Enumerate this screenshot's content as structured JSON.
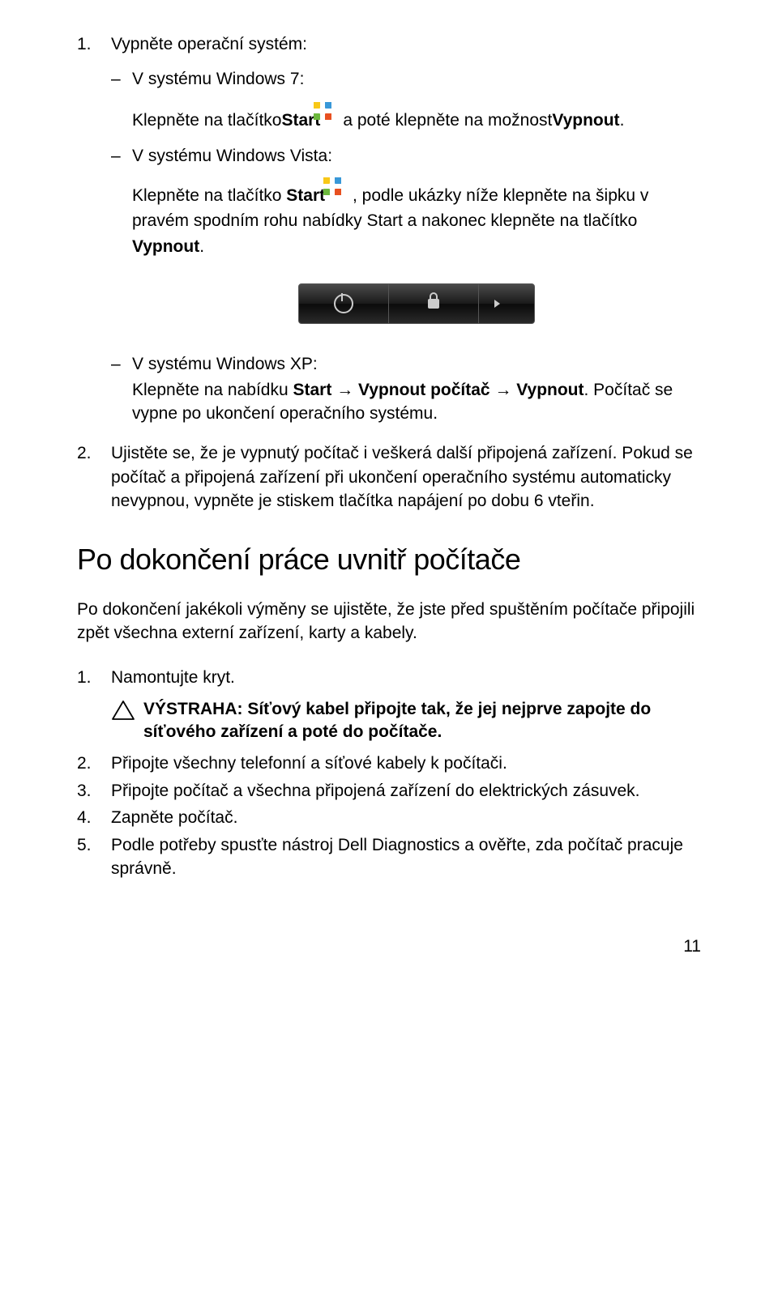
{
  "step1": {
    "num": "1.",
    "title": "Vypněte operační systém:",
    "win7": {
      "dash": "–",
      "label": "V systému Windows 7:",
      "click_pre": "Klepněte na tlačítko ",
      "start": "Start",
      "click_post": " a poté klepněte na možnost ",
      "vypnout": "Vypnout",
      "period": "."
    },
    "vista": {
      "dash": "–",
      "label": "V systému Windows Vista:",
      "line1_pre": "Klepněte na tlačítko ",
      "start": "Start",
      "line1_post": ", podle ukázky níže klepněte na šipku v pravém spodním rohu nabídky Start a nakonec klepněte na tlačítko ",
      "vypnout": "Vypnout",
      "period": "."
    },
    "xp": {
      "dash": "–",
      "label": "V systému Windows XP:",
      "line_pre": "Klepněte na nabídku ",
      "start": "Start",
      "arrow1": " → ",
      "vypnout_pc": "Vypnout počítač",
      "arrow2": " → ",
      "vypnout": "Vypnout",
      "line_post": ". Počítač se vypne po ukončení operačního systému."
    }
  },
  "step2": {
    "num": "2.",
    "text": "Ujistěte se, že je vypnutý počítač i veškerá další připojená zařízení. Pokud se počítač a připojená zařízení při ukončení operačního systému automaticky nevypnou, vypněte je stiskem tlačítka napájení po dobu 6 vteřin."
  },
  "heading": "Po dokončení práce uvnitř počítače",
  "intro": "Po dokončení jakékoli výměny se ujistěte, že jste před spuštěním počítače připojili zpět všechna externí zařízení, karty a kabely.",
  "steps_b": [
    {
      "num": "1.",
      "text": "Namontujte kryt."
    },
    {
      "num": "2.",
      "text": "Připojte všechny telefonní a síťové kabely k počítači."
    },
    {
      "num": "3.",
      "text": "Připojte počítač a všechna připojená zařízení do elektrických zásuvek."
    },
    {
      "num": "4.",
      "text": "Zapněte počítač."
    },
    {
      "num": "5.",
      "text": "Podle potřeby spusťte nástroj Dell Diagnostics a ověřte, zda počítač pracuje správně."
    }
  ],
  "warning": {
    "label": "VÝSTRAHA: Síťový kabel připojte tak, že jej nejprve zapojte do síťového zařízení a poté do počítače."
  },
  "page_num": "11"
}
